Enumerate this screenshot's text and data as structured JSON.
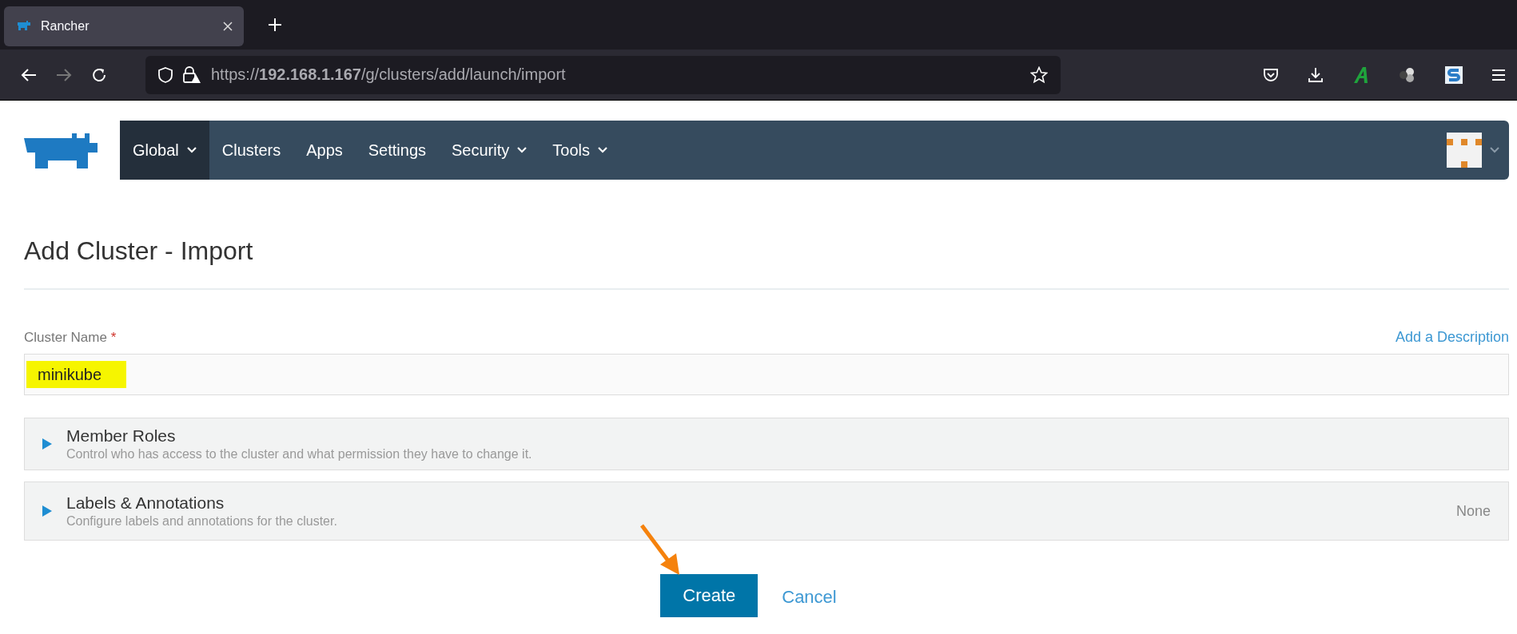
{
  "browser": {
    "tabs": [
      {
        "title": "Rancher",
        "selected": true
      }
    ],
    "url": "https://**192.168.1.167**/g/clusters/add/launch/import"
  },
  "nav": {
    "items": [
      {
        "label": "Global",
        "dropdown": true,
        "selected": true
      },
      {
        "label": "Clusters",
        "dropdown": false,
        "selected": false
      },
      {
        "label": "Apps",
        "dropdown": false,
        "selected": false
      },
      {
        "label": "Settings",
        "dropdown": false,
        "selected": false
      },
      {
        "label": "Security",
        "dropdown": true,
        "selected": false
      },
      {
        "label": "Tools",
        "dropdown": true,
        "selected": false
      }
    ]
  },
  "page": {
    "title": "Add Cluster - Import",
    "cluster_name": {
      "label": "Cluster Name",
      "required_mark": "*",
      "value": "minikube",
      "highlighted": true,
      "add_description": "Add a Description"
    },
    "panels": [
      {
        "title": "Member Roles",
        "description": "Control who has access to the cluster and what permission they have to change it.",
        "expanded": false
      },
      {
        "title": "Labels & Annotations",
        "description": "Configure labels and annotations for the cluster.",
        "status": "None",
        "expanded": false
      }
    ],
    "buttons": {
      "create": "Create",
      "cancel": "Cancel"
    }
  }
}
